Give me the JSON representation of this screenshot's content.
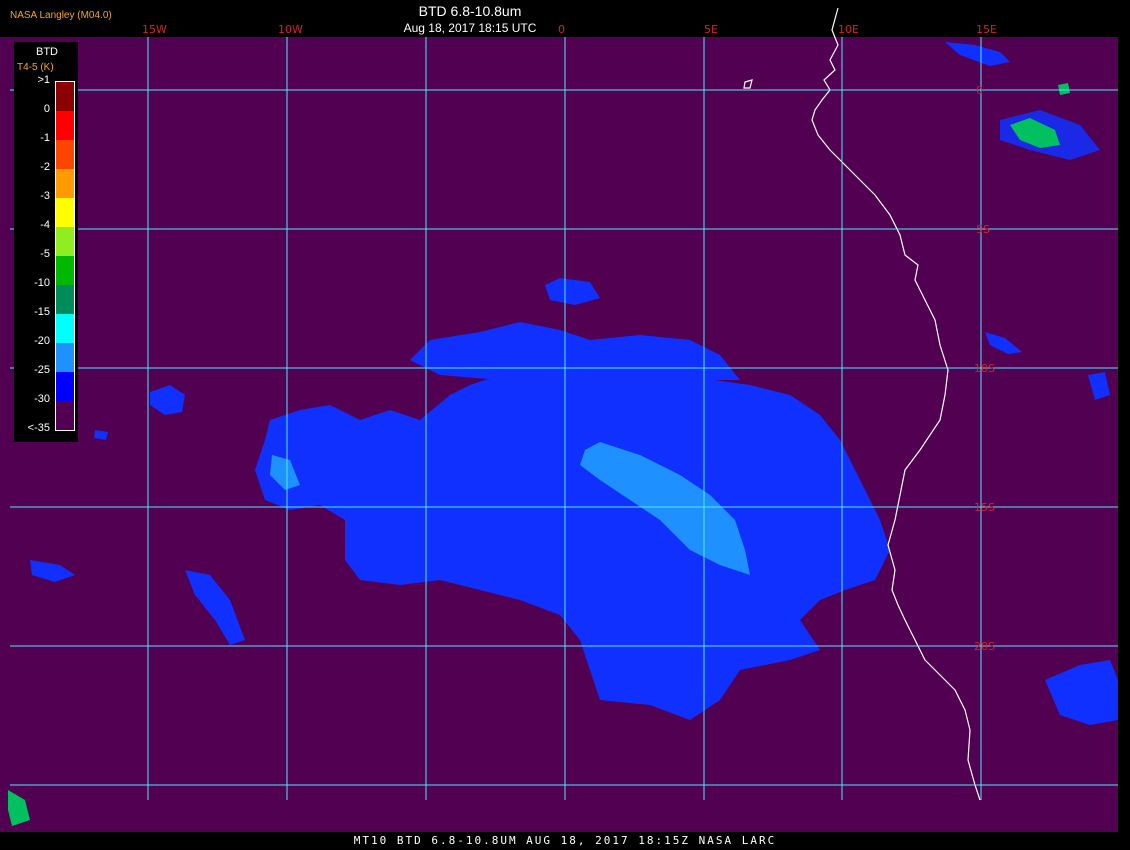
{
  "header": {
    "organization": "NASA Langley (M04.0)",
    "product_title": "BTD 6.8-10.8um",
    "timestamp": "Aug 18, 2017 18:15 UTC"
  },
  "footer_text": "MT10  BTD 6.8-10.8UM   AUG 18, 2017 18:15Z   NASA LARC",
  "legend": {
    "title": "BTD",
    "subtitle": "T4-5 (K)",
    "entries": [
      {
        "label": ">1",
        "color": "#8b0000"
      },
      {
        "label": "0",
        "color": "#ff0000"
      },
      {
        "label": "-1",
        "color": "#ff4500"
      },
      {
        "label": "-2",
        "color": "#ff9a00"
      },
      {
        "label": "-3",
        "color": "#ffff00"
      },
      {
        "label": "-4",
        "color": "#90ee20"
      },
      {
        "label": "-5",
        "color": "#00b800"
      },
      {
        "label": "-10",
        "color": "#008c5a"
      },
      {
        "label": "-15",
        "color": "#00ffff"
      },
      {
        "label": "-20",
        "color": "#1e90ff"
      },
      {
        "label": "-25",
        "color": "#0000ff"
      },
      {
        "label": "-30",
        "color": "#520052"
      },
      {
        "label": "<-35",
        "color": "#520052"
      }
    ]
  },
  "longitude_labels": [
    "15W",
    "10W",
    "0",
    "5E",
    "10E",
    "15E"
  ],
  "latitude_labels": [
    "0",
    "5S",
    "10S",
    "15S",
    "20S"
  ],
  "colors": {
    "background": "#520052",
    "grid": "#4fe8ff",
    "coastline": "#ffffff",
    "cloud_cold": "#1030ff",
    "cloud_core": "#1e90ff",
    "labels": "#d0222a"
  }
}
